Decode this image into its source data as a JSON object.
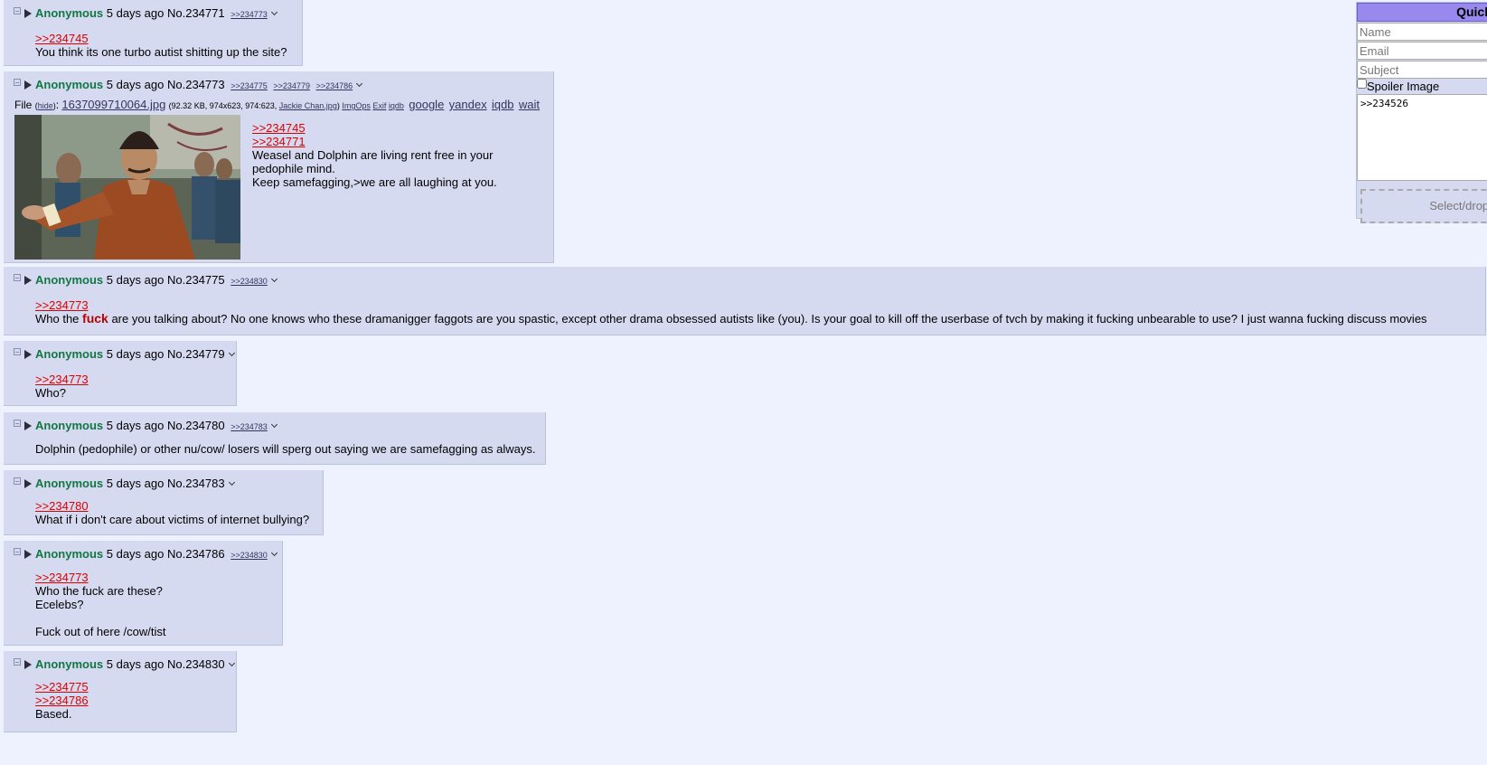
{
  "posts": [
    {
      "name": "Anonymous",
      "time": "5 days ago",
      "no": "No.234771",
      "backlinks": [
        ">>234773"
      ],
      "quotes": [
        ">>234745"
      ],
      "lines": [
        "You think its one turbo autist shitting up the site?"
      ]
    },
    {
      "name": "Anonymous",
      "time": "5 days ago",
      "no": "No.234773",
      "backlinks": [
        ">>234775",
        ">>234779",
        ">>234786"
      ],
      "file": {
        "label": "File",
        "hide": "hide",
        "filename": "1637099710064.jpg",
        "meta": "(92.32 KB, 974x623, 974:623,",
        "orig": "Jackie Chan.jpg",
        "close": ")",
        "tools": [
          "ImgOps",
          "Exif",
          "iqdb"
        ],
        "search": [
          "google",
          "yandex",
          "iqdb",
          "wait"
        ]
      },
      "quotes": [
        ">>234745",
        ">>234771"
      ],
      "lines": [
        "Weasel and Dolphin are living rent free in your",
        "pedophile mind.",
        "Keep samefagging,>we are all laughing at you."
      ]
    },
    {
      "name": "Anonymous",
      "time": "5 days ago",
      "no": "No.234775",
      "backlinks": [
        ">>234830"
      ],
      "quotes": [
        ">>234773"
      ],
      "text_before": "Who the ",
      "text_bold": "fuck",
      "text_after": " are you talking about? No one knows who these dramanigger faggots are you spastic, except other drama obsessed autists like (you). Is your goal to kill off the userbase of tvch by making it fucking unbearable to use? I just wanna fucking discuss movies"
    },
    {
      "name": "Anonymous",
      "time": "5 days ago",
      "no": "No.234779",
      "backlinks": [],
      "quotes": [
        ">>234773"
      ],
      "lines": [
        "Who?"
      ]
    },
    {
      "name": "Anonymous",
      "time": "5 days ago",
      "no": "No.234780",
      "backlinks": [
        ">>234783"
      ],
      "quotes": [],
      "lines": [
        "Dolphin (pedophile) or other nu/cow/ losers will sperg out saying we are samefagging as always."
      ]
    },
    {
      "name": "Anonymous",
      "time": "5 days ago",
      "no": "No.234783",
      "backlinks": [],
      "quotes": [
        ">>234780"
      ],
      "lines": [
        "What if i don't care about victims of internet bullying?"
      ]
    },
    {
      "name": "Anonymous",
      "time": "5 days ago",
      "no": "No.234786",
      "backlinks": [
        ">>234830"
      ],
      "quotes": [
        ">>234773"
      ],
      "lines": [
        "Who the fuck are these?",
        "Ecelebs?",
        "",
        "Fuck out of here /cow/tist"
      ]
    },
    {
      "name": "Anonymous",
      "time": "5 days ago",
      "no": "No.234830",
      "backlinks": [],
      "quotes": [
        ">>234775",
        ">>234786"
      ],
      "lines": [
        "Based."
      ]
    }
  ],
  "quick_reply": {
    "title": "Quick",
    "name_placeholder": "Name",
    "email_placeholder": "Email",
    "subject_placeholder": "Subject",
    "spoiler_label": "Spoiler Image",
    "comment_value": ">>234526",
    "drop_label": "Select/drop/p"
  }
}
